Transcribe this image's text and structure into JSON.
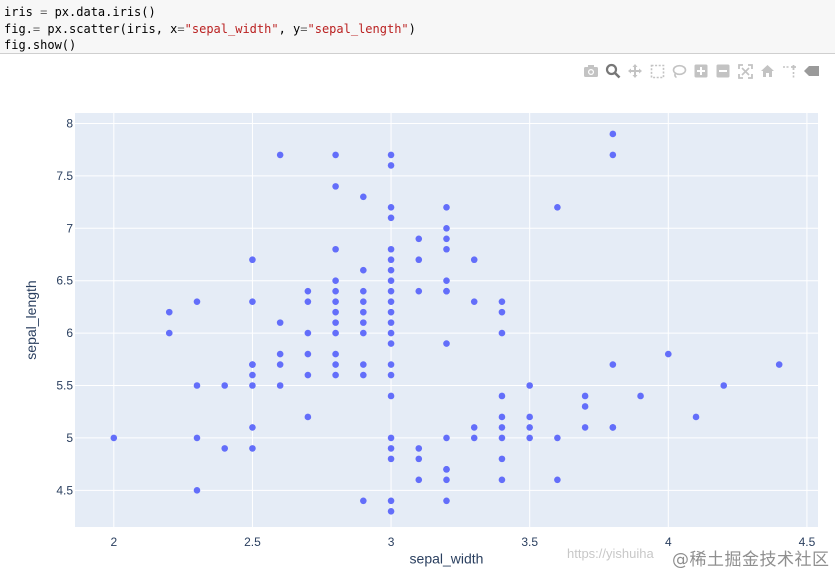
{
  "code": {
    "line1": {
      "a": "iris ",
      "b": "=",
      "c": " px.data.iris()"
    },
    "line2": {
      "a": "fig.",
      "b": "=",
      "c": " px.scatter(iris, x",
      "d": "=",
      "e": "\"sepal_width\"",
      "f": ", y",
      "g": "=",
      "h": "\"sepal_length\"",
      "i": ")"
    },
    "line3": "fig.show()"
  },
  "modebar": {
    "icons": [
      "camera-icon",
      "zoom-icon",
      "pan-icon",
      "box-select-icon",
      "lasso-icon",
      "zoom-in-icon",
      "zoom-out-icon",
      "autoscale-icon",
      "home-icon",
      "spike-lines-icon",
      "hover-compare-icon"
    ]
  },
  "colors": {
    "plot_bg": "#e5ecf6",
    "marker": "#636efa",
    "axis_text": "#2a3f5f",
    "grid": "#ffffff"
  },
  "chart_data": {
    "type": "scatter",
    "xlabel": "sepal_width",
    "ylabel": "sepal_length",
    "xlim": [
      1.86,
      4.54
    ],
    "ylim": [
      4.15,
      8.1
    ],
    "xticks": [
      2,
      2.5,
      3,
      3.5,
      4,
      4.5
    ],
    "xtick_labels": [
      "2",
      "2.5",
      "3",
      "3.5",
      "4",
      "4.5"
    ],
    "yticks": [
      4.5,
      5,
      5.5,
      6,
      6.5,
      7,
      7.5,
      8
    ],
    "ytick_labels": [
      "4.5",
      "5",
      "5.5",
      "6",
      "6.5",
      "7",
      "7.5",
      "8"
    ],
    "grid": true,
    "x": [
      2.0,
      2.2,
      2.2,
      2.3,
      2.3,
      2.3,
      2.3,
      2.4,
      2.4,
      2.5,
      2.5,
      2.5,
      2.5,
      2.5,
      2.5,
      2.5,
      2.5,
      2.6,
      2.6,
      2.6,
      2.6,
      2.6,
      2.7,
      2.7,
      2.7,
      2.7,
      2.7,
      2.7,
      2.8,
      2.8,
      2.8,
      2.8,
      2.8,
      2.8,
      2.8,
      2.8,
      2.8,
      2.8,
      2.8,
      2.8,
      2.9,
      2.9,
      2.9,
      2.9,
      2.9,
      2.9,
      2.9,
      2.9,
      2.9,
      2.9,
      3.0,
      3.0,
      3.0,
      3.0,
      3.0,
      3.0,
      3.0,
      3.0,
      3.0,
      3.0,
      3.0,
      3.0,
      3.0,
      3.0,
      3.0,
      3.0,
      3.0,
      3.0,
      3.0,
      3.0,
      3.0,
      3.0,
      3.1,
      3.1,
      3.1,
      3.1,
      3.1,
      3.1,
      3.2,
      3.2,
      3.2,
      3.2,
      3.2,
      3.2,
      3.2,
      3.2,
      3.2,
      3.2,
      3.2,
      3.2,
      3.2,
      3.3,
      3.3,
      3.3,
      3.3,
      3.4,
      3.4,
      3.4,
      3.4,
      3.4,
      3.4,
      3.4,
      3.4,
      3.4,
      3.5,
      3.5,
      3.5,
      3.5,
      3.6,
      3.6,
      3.6,
      3.7,
      3.7,
      3.7,
      3.8,
      3.8,
      3.8,
      3.8,
      3.8,
      3.9,
      4.0,
      4.1,
      4.2,
      4.4
    ],
    "y": [
      5.0,
      6.0,
      6.2,
      4.5,
      5.0,
      5.5,
      6.3,
      4.9,
      5.5,
      4.9,
      5.1,
      5.5,
      5.6,
      5.7,
      6.3,
      6.7,
      5.7,
      5.5,
      5.7,
      5.8,
      6.1,
      7.7,
      5.2,
      5.6,
      5.8,
      6.0,
      6.3,
      6.4,
      5.6,
      5.7,
      5.8,
      6.1,
      6.2,
      6.3,
      6.4,
      6.5,
      6.8,
      7.4,
      7.7,
      6.0,
      4.4,
      5.6,
      5.7,
      6.0,
      6.1,
      6.2,
      6.3,
      6.4,
      6.6,
      7.3,
      4.3,
      4.4,
      4.8,
      4.9,
      5.0,
      5.4,
      5.6,
      5.7,
      5.9,
      6.0,
      6.1,
      6.5,
      6.6,
      6.7,
      6.8,
      7.1,
      7.2,
      7.6,
      7.7,
      6.3,
      6.4,
      6.2,
      4.6,
      4.8,
      4.9,
      6.4,
      6.7,
      6.9,
      4.4,
      4.6,
      4.7,
      5.0,
      5.9,
      6.4,
      6.5,
      6.8,
      6.9,
      7.0,
      7.2,
      6.4,
      4.7,
      5.0,
      5.1,
      6.3,
      6.7,
      4.6,
      4.8,
      5.0,
      5.1,
      5.2,
      5.4,
      6.0,
      6.2,
      6.3,
      5.0,
      5.1,
      5.2,
      5.5,
      4.6,
      5.0,
      7.2,
      5.1,
      5.3,
      5.4,
      5.1,
      5.7,
      7.7,
      7.9,
      5.1,
      5.4,
      5.8,
      5.2,
      5.5,
      5.7
    ]
  },
  "watermark": {
    "url": "https://yishuiha",
    "brand": "@稀土掘金技术社区"
  }
}
